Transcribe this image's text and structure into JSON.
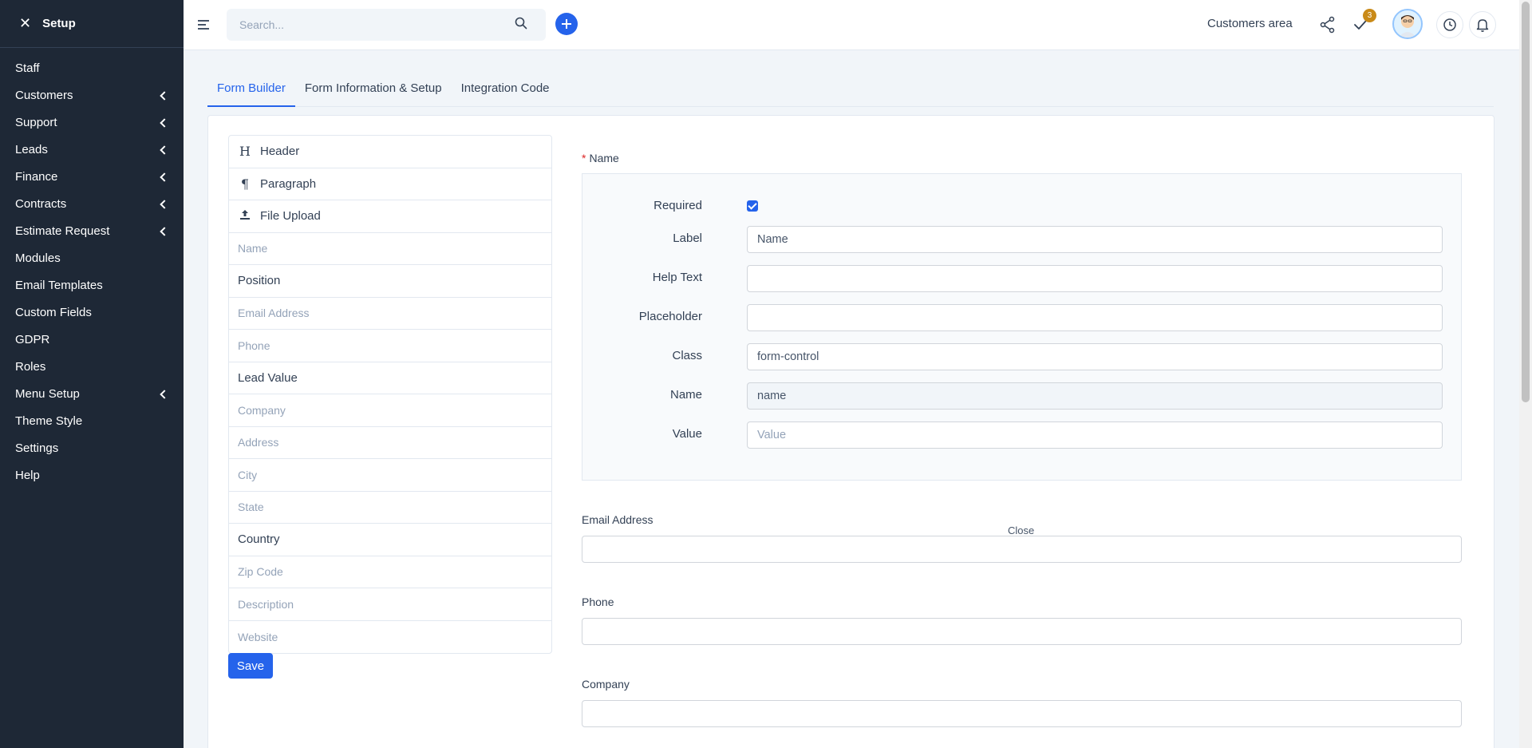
{
  "sidebar": {
    "title": "Setup",
    "items": [
      {
        "label": "Staff",
        "has_children": false
      },
      {
        "label": "Customers",
        "has_children": true
      },
      {
        "label": "Support",
        "has_children": true
      },
      {
        "label": "Leads",
        "has_children": true
      },
      {
        "label": "Finance",
        "has_children": true
      },
      {
        "label": "Contracts",
        "has_children": true
      },
      {
        "label": "Estimate Request",
        "has_children": true
      },
      {
        "label": "Modules",
        "has_children": false
      },
      {
        "label": "Email Templates",
        "has_children": false
      },
      {
        "label": "Custom Fields",
        "has_children": false
      },
      {
        "label": "GDPR",
        "has_children": false
      },
      {
        "label": "Roles",
        "has_children": false
      },
      {
        "label": "Menu Setup",
        "has_children": true
      },
      {
        "label": "Theme Style",
        "has_children": false
      },
      {
        "label": "Settings",
        "has_children": false
      },
      {
        "label": "Help",
        "has_children": false
      }
    ]
  },
  "topbar": {
    "search_placeholder": "Search...",
    "customers_area": "Customers area",
    "tasks_badge": "3",
    "accent": "#2563eb"
  },
  "tabs": [
    {
      "label": "Form Builder",
      "active": true
    },
    {
      "label": "Form Information & Setup",
      "active": false
    },
    {
      "label": "Integration Code",
      "active": false
    }
  ],
  "fields_panel": {
    "tools": [
      {
        "icon": "heading-icon",
        "glyph": "H",
        "label": "Header"
      },
      {
        "icon": "paragraph-icon",
        "glyph": "¶",
        "label": "Paragraph"
      },
      {
        "icon": "upload-icon",
        "glyph": "",
        "label": "File Upload"
      }
    ],
    "fields": [
      {
        "label": "Name",
        "used": true
      },
      {
        "label": "Position",
        "used": false
      },
      {
        "label": "Email Address",
        "used": true
      },
      {
        "label": "Phone",
        "used": true
      },
      {
        "label": "Lead Value",
        "used": false
      },
      {
        "label": "Company",
        "used": true
      },
      {
        "label": "Address",
        "used": true
      },
      {
        "label": "City",
        "used": true
      },
      {
        "label": "State",
        "used": true
      },
      {
        "label": "Country",
        "used": false
      },
      {
        "label": "Zip Code",
        "used": true
      },
      {
        "label": "Description",
        "used": true
      },
      {
        "label": "Website",
        "used": true
      }
    ],
    "save_label": "Save"
  },
  "editor": {
    "field_title": "Name",
    "required_mark": "*",
    "required_label": "Required",
    "required_checked": true,
    "label_label": "Label",
    "label_value": "Name",
    "help_label": "Help Text",
    "help_value": "",
    "placeholder_label": "Placeholder",
    "placeholder_value": "",
    "class_label": "Class",
    "class_value": "form-control",
    "name_label": "Name",
    "name_value": "name",
    "value_label": "Value",
    "value_placeholder": "Value",
    "close_label": "Close"
  },
  "preview_fields": [
    {
      "label": "Email Address"
    },
    {
      "label": "Phone"
    },
    {
      "label": "Company"
    }
  ]
}
